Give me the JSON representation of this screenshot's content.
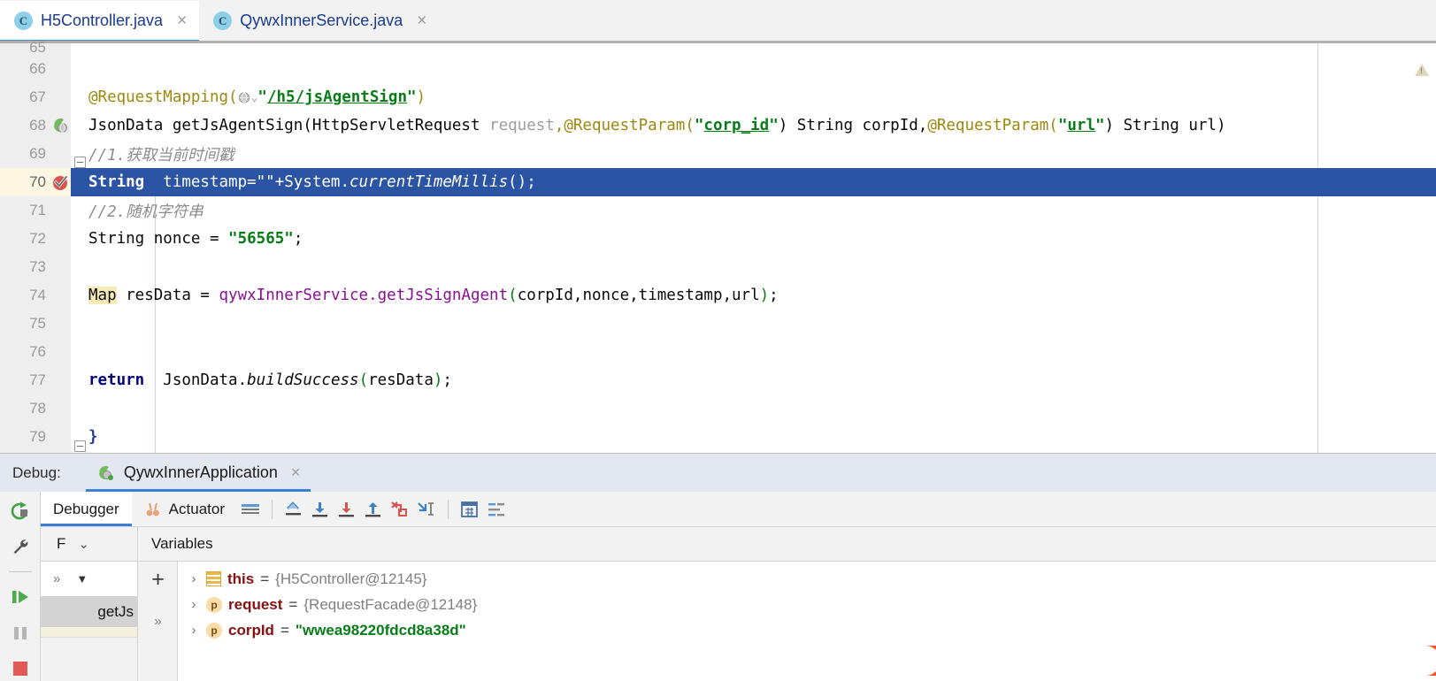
{
  "editor_tabs": [
    {
      "label": "H5Controller.java",
      "icon": "java-class-icon",
      "badge": "C",
      "active": true,
      "close": "×"
    },
    {
      "label": "QywxInnerService.java",
      "icon": "java-class-icon",
      "badge": "C",
      "active": false,
      "close": "×"
    }
  ],
  "editor": {
    "lines": [
      {
        "num": "65",
        "partial": true
      },
      {
        "num": "66"
      },
      {
        "num": "67"
      },
      {
        "num": "68",
        "gutter_icon": "spring-web-mapping-icon"
      },
      {
        "num": "69"
      },
      {
        "num": "70",
        "gutter_icon": "breakpoint-verified-icon",
        "current": true
      },
      {
        "num": "71"
      },
      {
        "num": "72"
      },
      {
        "num": "73"
      },
      {
        "num": "74"
      },
      {
        "num": "75"
      },
      {
        "num": "76"
      },
      {
        "num": "77"
      },
      {
        "num": "78"
      },
      {
        "num": "79"
      }
    ],
    "code": {
      "l67_annotation": "@RequestMapping(",
      "l67_globe": "globe-icon",
      "l67_chevron": "⌄",
      "l67_quote_open": "\"",
      "l67_path": "/h5/jsAgentSign",
      "l67_quote_close": "\"",
      "l67_end": ")",
      "l68_a": "JsonData getJsAgentSign(HttpServletRequest ",
      "l68_param1": "request",
      "l68_b": ",",
      "l68_ann2": "@RequestParam(",
      "l68_q1": "\"",
      "l68_corpid": "corp_id",
      "l68_q2": "\"",
      "l68_c": ") String corpId,",
      "l68_ann3": "@RequestParam(",
      "l68_q3": "\"",
      "l68_url": "url",
      "l68_q4": "\"",
      "l68_d": ") String url)",
      "l69_comment": "//1.获取当前时间戳",
      "l70_kw": "String",
      "l70_rest": "  timestamp=\"\"+System.",
      "l70_static": "currentTimeMillis",
      "l70_tail": "();",
      "l71_comment": "//2.随机字符串",
      "l72_a": "String nonce = ",
      "l72_str": "\"56565\"",
      "l72_b": ";",
      "l74_map": "Map",
      "l74_a": " resData = ",
      "l74_field": "qywxInnerService",
      "l74_b": ".getJsSignAgent",
      "l74_paren_open": "(",
      "l74_args": "corpId,nonce,timestamp,url",
      "l74_paren_close": ")",
      "l74_semi": ";",
      "l77_return": "return",
      "l77_a": "  JsonData.",
      "l77_static": "buildSuccess",
      "l77_paren_open": "(",
      "l77_arg": "resData",
      "l77_paren_close": ")",
      "l77_semi": ";",
      "l79_brace": "}"
    },
    "warning_icon": "warning-triangle-icon"
  },
  "debug": {
    "label": "Debug:",
    "run_config": {
      "name": "QywxInnerApplication",
      "icon": "spring-boot-icon",
      "close": "×"
    },
    "side_actions": [
      {
        "name": "rerun-icon"
      },
      {
        "name": "settings-wrench-icon"
      },
      {
        "name": "resume-program-icon"
      },
      {
        "name": "pause-program-icon"
      },
      {
        "name": "stop-program-icon"
      }
    ],
    "tabs": [
      {
        "label": "Debugger",
        "icon": null,
        "active": true
      },
      {
        "label": "Actuator",
        "icon": "actuator-icon",
        "active": false
      },
      {
        "label": "",
        "icon": "console-icon",
        "active": false
      }
    ],
    "toolbar_icons": [
      "show-execution-point-icon",
      "step-over-icon",
      "step-into-icon",
      "force-step-into-icon",
      "step-out-icon",
      "drop-frame-icon",
      "run-to-cursor-icon",
      "evaluate-expression-icon",
      "mute-breakpoints-icon"
    ],
    "frames": {
      "header_label": "F",
      "header_chevron": "⌄",
      "more_label": "»",
      "dropdown_arrow": "▼",
      "items": [
        {
          "label": "getJs"
        }
      ]
    },
    "variables": {
      "header_label": "Variables",
      "add_label": "+",
      "more_label": "»",
      "rows": [
        {
          "chevron": "›",
          "icon": "this-object-icon",
          "badge": "",
          "name": "this",
          "eq": "=",
          "value": "{H5Controller@12145}",
          "is_string": false
        },
        {
          "chevron": "›",
          "icon": "parameter-icon",
          "badge": "p",
          "name": "request",
          "eq": "=",
          "value": "{RequestFacade@12148}",
          "is_string": false
        },
        {
          "chevron": "›",
          "icon": "parameter-icon",
          "badge": "p",
          "name": "corpId",
          "eq": "=",
          "value": "\"wwea98220fdcd8a38d\"",
          "is_string": true
        }
      ]
    }
  },
  "colors": {
    "accent": "#3c7eda",
    "current_line": "#2b54a4",
    "string": "#067d17",
    "keyword": "#000080",
    "annotation": "#9e880d",
    "field": "#871094",
    "breakpoint": "#d9534f"
  }
}
